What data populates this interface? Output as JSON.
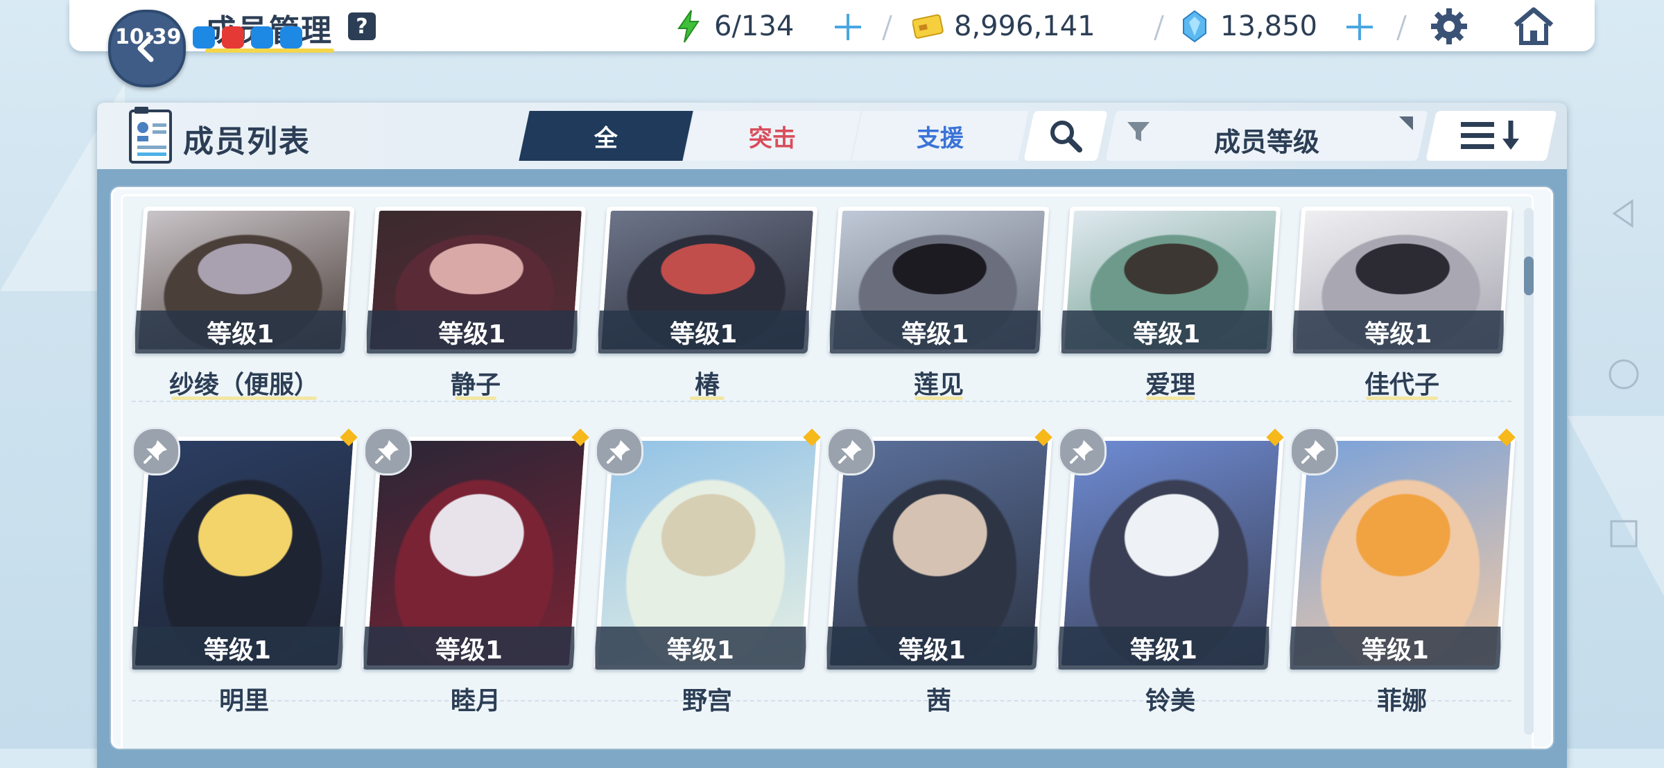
{
  "status_bar": {
    "time": "10:39"
  },
  "header": {
    "title": "成员管理",
    "help_label": "?"
  },
  "resources": {
    "ap": "6/134",
    "credits": "8,996,141",
    "pyroxene": "13,850"
  },
  "panel": {
    "title": "成员列表",
    "tabs": [
      {
        "label": "全",
        "active": true
      },
      {
        "label": "突击",
        "active": false
      },
      {
        "label": "支援",
        "active": false
      }
    ],
    "filter_label": "成员等级"
  },
  "members": [
    {
      "name": "纱绫（便服）",
      "level": "等级1",
      "palette": [
        "#c9c4c8",
        "#a9a0b0",
        "#4b3f3a"
      ],
      "pinned": false
    },
    {
      "name": "静子",
      "level": "等级1",
      "palette": [
        "#3a2a2e",
        "#d9a9a8",
        "#5a2b36"
      ],
      "pinned": false
    },
    {
      "name": "椿",
      "level": "等级1",
      "palette": [
        "#6c7488",
        "#c24e4c",
        "#2b2d3a"
      ],
      "pinned": false
    },
    {
      "name": "莲见",
      "level": "等级1",
      "palette": [
        "#bfc8d6",
        "#1d1b22",
        "#6b6f7d"
      ],
      "pinned": false
    },
    {
      "name": "爱理",
      "level": "等级1",
      "palette": [
        "#dfe9ef",
        "#3d3733",
        "#6d9a8b"
      ],
      "pinned": false
    },
    {
      "name": "佳代子",
      "level": "等级1",
      "palette": [
        "#efeff2",
        "#2c2a33",
        "#a8a7b2"
      ],
      "pinned": false
    },
    {
      "name": "明里",
      "level": "等级1",
      "palette": [
        "#2b3e63",
        "#f3d46b",
        "#1f2432"
      ],
      "pinned": true
    },
    {
      "name": "睦月",
      "level": "等级1",
      "palette": [
        "#2a2636",
        "#e8e3ea",
        "#7a2334"
      ],
      "pinned": true
    },
    {
      "name": "野宫",
      "level": "等级1",
      "palette": [
        "#93c3e6",
        "#d7cfb4",
        "#e6efe4"
      ],
      "pinned": true
    },
    {
      "name": "茜",
      "level": "等级1",
      "palette": [
        "#5a6f9a",
        "#d5c2b2",
        "#2d3444"
      ],
      "pinned": true
    },
    {
      "name": "铃美",
      "level": "等级1",
      "palette": [
        "#6e8bd3",
        "#eef2f7",
        "#3a3f55"
      ],
      "pinned": true
    },
    {
      "name": "菲娜",
      "level": "等级1",
      "palette": [
        "#7ba2d9",
        "#f2a341",
        "#f0c9a6"
      ],
      "pinned": true
    }
  ],
  "colors": {
    "tab_active_bg": "#1f3a5a",
    "striker_text": "#d94d5c",
    "special_text": "#3b73d8",
    "pin_diamond": "#f6b81b"
  },
  "icons": {
    "back": "arrow-left-icon",
    "ap": "lightning-icon",
    "credits": "credit-card-icon",
    "pyroxene": "gem-icon",
    "settings": "gear-icon",
    "home": "home-icon",
    "search": "search-icon",
    "filter": "funnel-icon",
    "sort": "sort-icon",
    "pin": "pin-icon"
  }
}
